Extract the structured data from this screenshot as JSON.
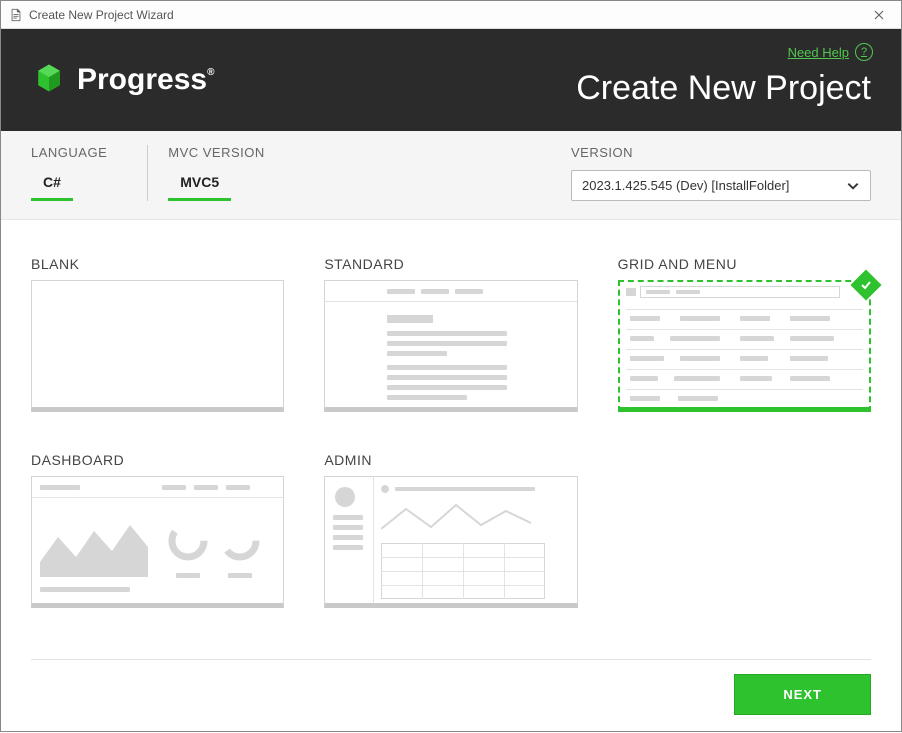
{
  "window": {
    "title": "Create New Project Wizard"
  },
  "header": {
    "brand": "Progress",
    "brand_mark": "®",
    "page_title": "Create New Project",
    "help_label": "Need Help"
  },
  "config": {
    "language_label": "LANGUAGE",
    "language_value": "C#",
    "mvc_label": "MVC VERSION",
    "mvc_value": "MVC5",
    "version_label": "VERSION",
    "version_selected": "2023.1.425.545 (Dev) [InstallFolder]"
  },
  "templates": [
    {
      "id": "blank",
      "label": "BLANK",
      "selected": false
    },
    {
      "id": "standard",
      "label": "STANDARD",
      "selected": false
    },
    {
      "id": "grid-and-menu",
      "label": "GRID AND MENU",
      "selected": true
    },
    {
      "id": "dashboard",
      "label": "DASHBOARD",
      "selected": false
    },
    {
      "id": "admin",
      "label": "ADMIN",
      "selected": false
    }
  ],
  "footer": {
    "next_label": "NEXT"
  },
  "colors": {
    "accent": "#2ec22e",
    "header_bg": "#2b2b2b"
  }
}
